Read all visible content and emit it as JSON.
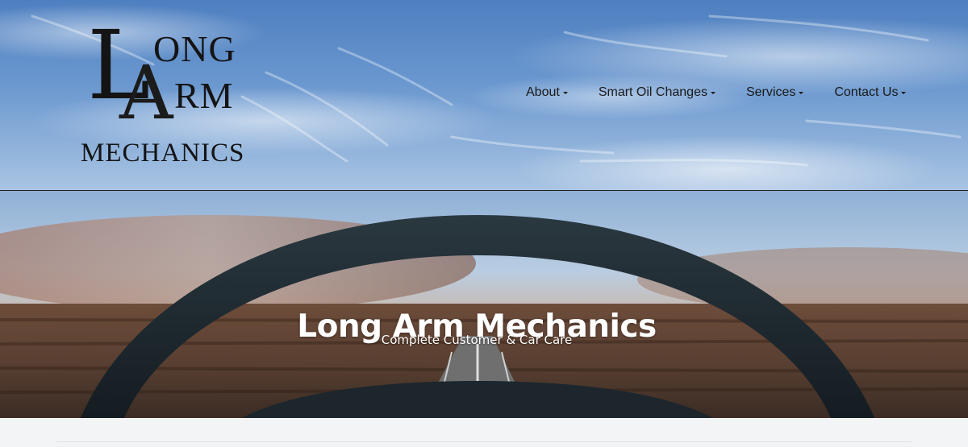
{
  "logo": {
    "big_l": "L",
    "big_a": "A",
    "ong": "ONG",
    "rm": "RM",
    "mechanics": "MECHANICS"
  },
  "nav": {
    "items": [
      {
        "label": "About"
      },
      {
        "label": "Smart Oil Changes"
      },
      {
        "label": "Services"
      },
      {
        "label": "Contact Us"
      }
    ]
  },
  "hero": {
    "title": "Long Arm Mechanics",
    "subtitle": "Complete Customer & Car Care"
  },
  "colors": {
    "sky": "#6b98cf",
    "wheel": "#1f2c33",
    "road": "#6e5647",
    "text_dark": "#1a1a1a",
    "hero_text": "#ffffff"
  }
}
